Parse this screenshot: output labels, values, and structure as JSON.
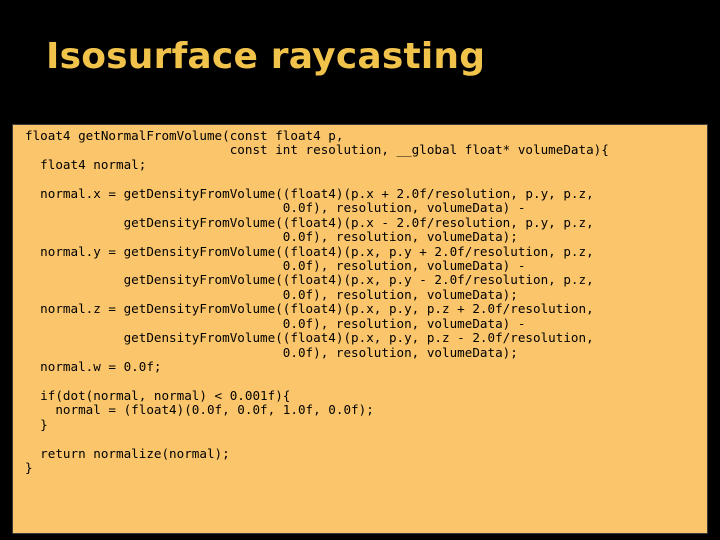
{
  "slide": {
    "title": "Isosurface raycasting",
    "code_lines": [
      "float4 getNormalFromVolume(const float4 p,",
      "                           const int resolution, __global float* volumeData){",
      "  float4 normal;",
      "",
      "  normal.x = getDensityFromVolume((float4)(p.x + 2.0f/resolution, p.y, p.z,",
      "                                  0.0f), resolution, volumeData) -",
      "             getDensityFromVolume((float4)(p.x - 2.0f/resolution, p.y, p.z,",
      "                                  0.0f), resolution, volumeData);",
      "  normal.y = getDensityFromVolume((float4)(p.x, p.y + 2.0f/resolution, p.z,",
      "                                  0.0f), resolution, volumeData) -",
      "             getDensityFromVolume((float4)(p.x, p.y - 2.0f/resolution, p.z,",
      "                                  0.0f), resolution, volumeData);",
      "  normal.z = getDensityFromVolume((float4)(p.x, p.y, p.z + 2.0f/resolution,",
      "                                  0.0f), resolution, volumeData) -",
      "             getDensityFromVolume((float4)(p.x, p.y, p.z - 2.0f/resolution,",
      "                                  0.0f), resolution, volumeData);",
      "  normal.w = 0.0f;",
      "",
      "  if(dot(normal, normal) < 0.001f){",
      "    normal = (float4)(0.0f, 0.0f, 1.0f, 0.0f);",
      "  }",
      "",
      "  return normalize(normal);",
      "}"
    ]
  },
  "colors": {
    "background": "#000000",
    "title": "#f1c34b",
    "panel": "#fbc66b",
    "code_text": "#000000"
  }
}
